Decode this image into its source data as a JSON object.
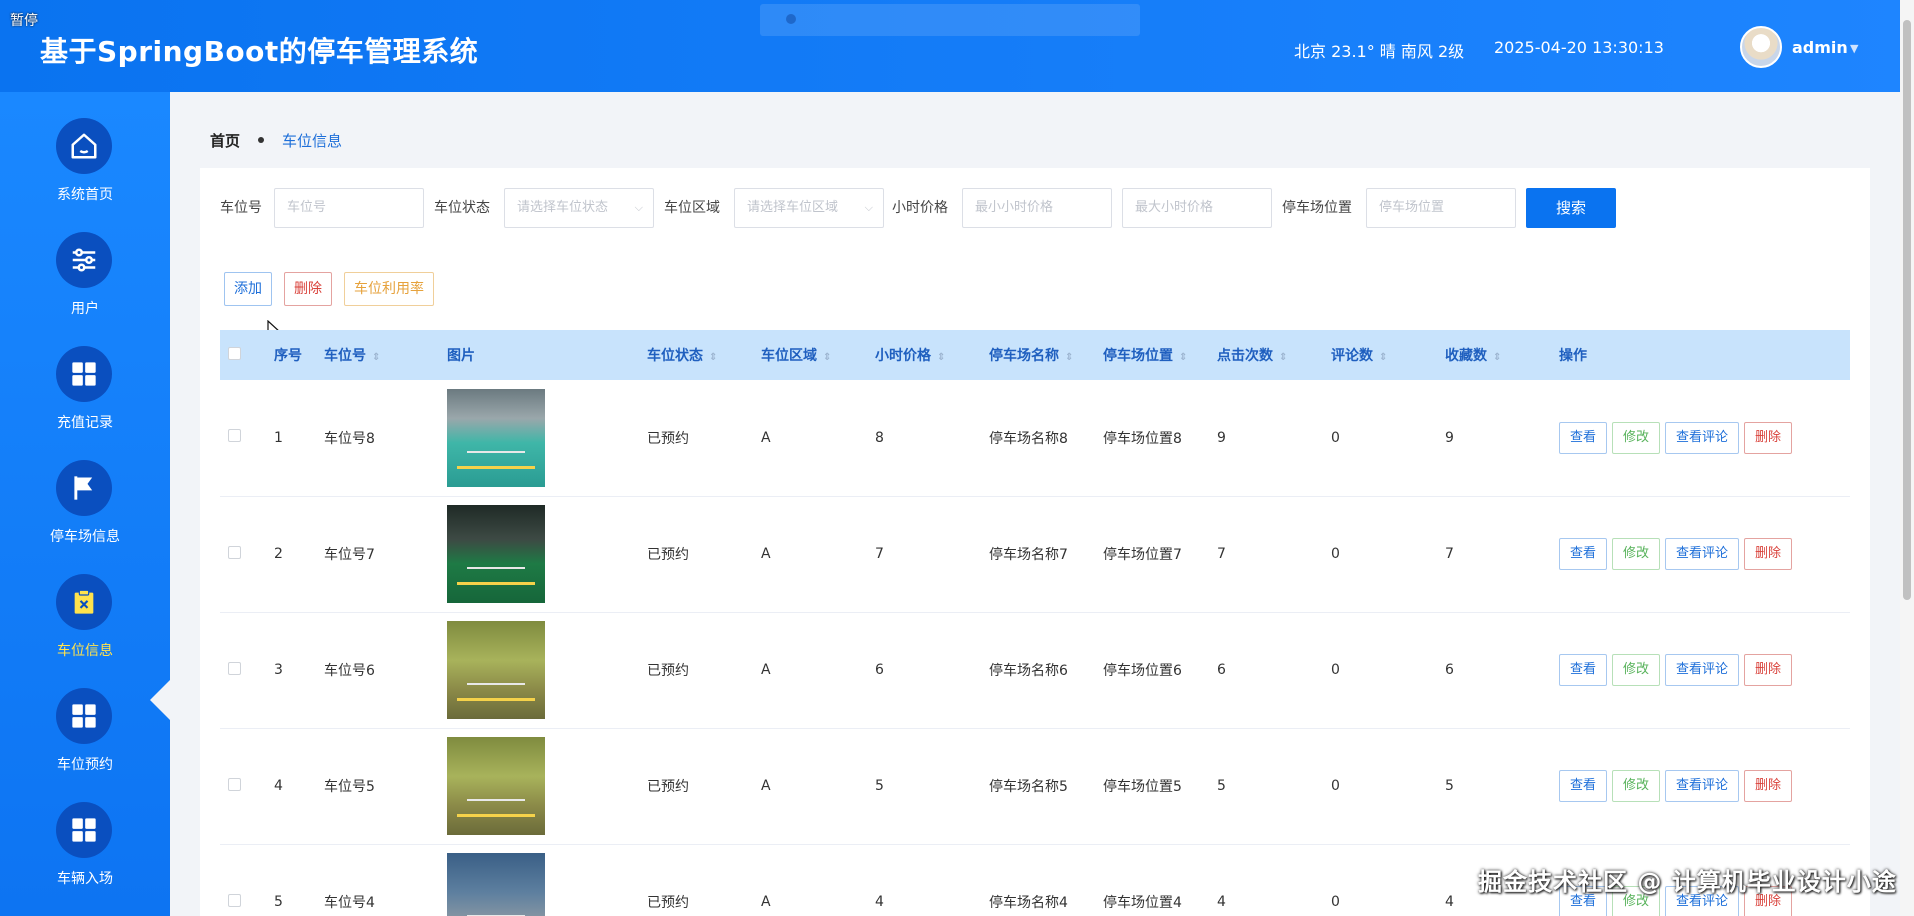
{
  "header": {
    "pause_label": "暂停",
    "title": "基于SpringBoot的停车管理系统",
    "weather": "北京  23.1°  晴  南风  2级",
    "datetime": "2025-04-20 13:30:13",
    "username": "admin"
  },
  "sidebar": {
    "items": [
      {
        "label": "系统首页",
        "icon": "home-icon"
      },
      {
        "label": "用户",
        "icon": "sliders-icon"
      },
      {
        "label": "充值记录",
        "icon": "grid-icon"
      },
      {
        "label": "停车场信息",
        "icon": "flag-icon"
      },
      {
        "label": "车位信息",
        "icon": "clipboard-x-icon",
        "active": true
      },
      {
        "label": "车位预约",
        "icon": "grid-icon"
      },
      {
        "label": "车辆入场",
        "icon": "grid-icon"
      }
    ]
  },
  "breadcrumb": {
    "home": "首页",
    "current": "车位信息"
  },
  "search": {
    "slot_no_label": "车位号",
    "slot_no_placeholder": "车位号",
    "status_label": "车位状态",
    "status_placeholder": "请选择车位状态",
    "area_label": "车位区域",
    "area_placeholder": "请选择车位区域",
    "price_label": "小时价格",
    "price_min_placeholder": "最小小时价格",
    "price_max_placeholder": "最大小时价格",
    "location_label": "停车场位置",
    "location_placeholder": "停车场位置",
    "search_button": "搜索"
  },
  "actions": {
    "add": "添加",
    "delete": "删除",
    "utilization": "车位利用率"
  },
  "table": {
    "columns": [
      "序号",
      "车位号",
      "图片",
      "车位状态",
      "车位区域",
      "小时价格",
      "停车场名称",
      "停车场位置",
      "点击次数",
      "评论数",
      "收藏数",
      "操作"
    ],
    "row_buttons": {
      "view": "查看",
      "edit": "修改",
      "comments": "查看评论",
      "delete": "删除"
    },
    "rows": [
      {
        "idx": "1",
        "slot": "车位号8",
        "status": "已预约",
        "area": "A",
        "price": "8",
        "lot_name": "停车场名称8",
        "lot_loc": "停车场位置8",
        "clicks": "9",
        "comments": "0",
        "favs": "9"
      },
      {
        "idx": "2",
        "slot": "车位号7",
        "status": "已预约",
        "area": "A",
        "price": "7",
        "lot_name": "停车场名称7",
        "lot_loc": "停车场位置7",
        "clicks": "7",
        "comments": "0",
        "favs": "7"
      },
      {
        "idx": "3",
        "slot": "车位号6",
        "status": "已预约",
        "area": "A",
        "price": "6",
        "lot_name": "停车场名称6",
        "lot_loc": "停车场位置6",
        "clicks": "6",
        "comments": "0",
        "favs": "6"
      },
      {
        "idx": "4",
        "slot": "车位号5",
        "status": "已预约",
        "area": "A",
        "price": "5",
        "lot_name": "停车场名称5",
        "lot_loc": "停车场位置5",
        "clicks": "5",
        "comments": "0",
        "favs": "5"
      },
      {
        "idx": "5",
        "slot": "车位号4",
        "status": "已预约",
        "area": "A",
        "price": "4",
        "lot_name": "停车场名称4",
        "lot_loc": "停车场位置4",
        "clicks": "4",
        "comments": "0",
        "favs": "4"
      }
    ]
  },
  "watermark": "掘金技术社区 @ 计算机毕业设计小途",
  "colors": {
    "primary": "#0a73f0",
    "sidebar": "#1a88ff",
    "active_nav": "#ffe34d",
    "table_header": "#c8e3fc",
    "danger": "#d9413a",
    "success": "#57b25a",
    "warning": "#e6a23c"
  }
}
